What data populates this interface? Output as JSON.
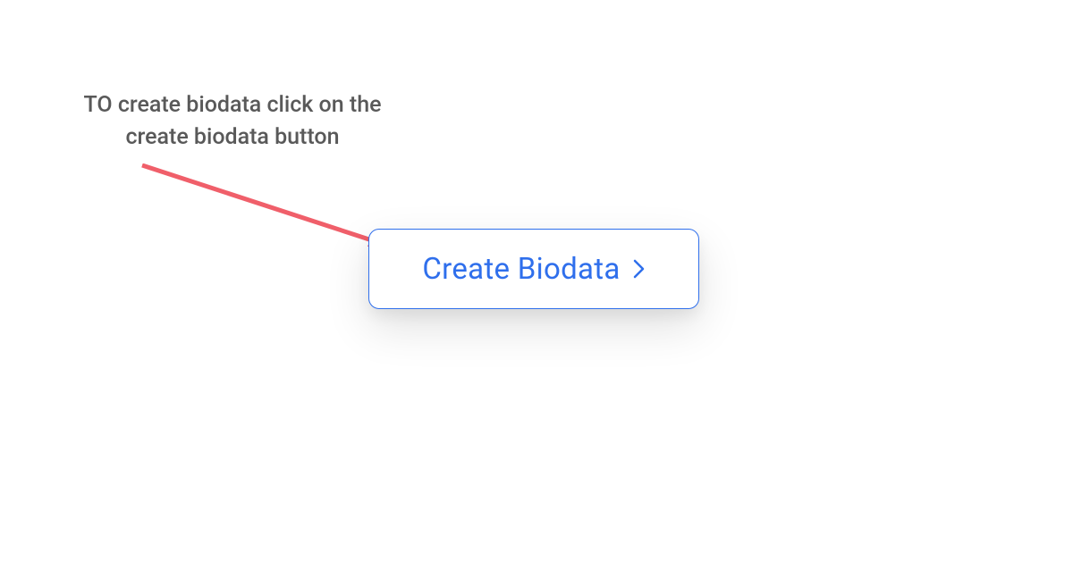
{
  "instruction": {
    "text": "TO create biodata click on the create biodata button"
  },
  "button": {
    "label": "Create Biodata"
  },
  "colors": {
    "accent_blue": "#2f6fec",
    "arrow_red": "#f05f6a",
    "text_gray": "#595959"
  }
}
